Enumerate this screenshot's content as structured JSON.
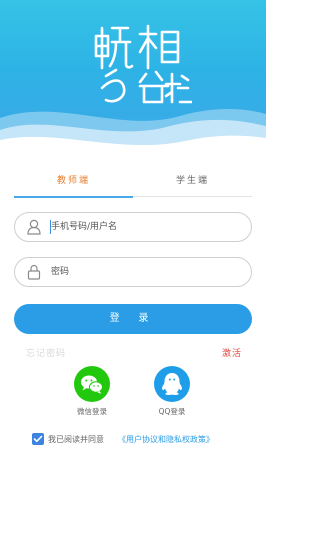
{
  "tabs": {
    "teacher": "教师端",
    "student": "学生端"
  },
  "fields": {
    "username_placeholder": "手机号码/用户名",
    "password_placeholder": "密码"
  },
  "login_label": "登 录",
  "forgot_label": "忘记密码",
  "activate_label": "激活",
  "social": {
    "wechat_label": "微信登录",
    "qq_label": "QQ登录"
  },
  "agreement": {
    "prefix": "我已阅读并同意",
    "link": "《用户协议和隐私权政策》",
    "checked": true
  },
  "icons": [
    "user-icon",
    "lock-icon",
    "wechat-icon",
    "qq-icon",
    "check-icon",
    "app-logo"
  ],
  "colors": {
    "accent": "#2a9de6",
    "tab_active": "#e97d2e",
    "activate": "#e0463a",
    "wechat": "#22c80e",
    "qq": "#1e9ee8"
  }
}
